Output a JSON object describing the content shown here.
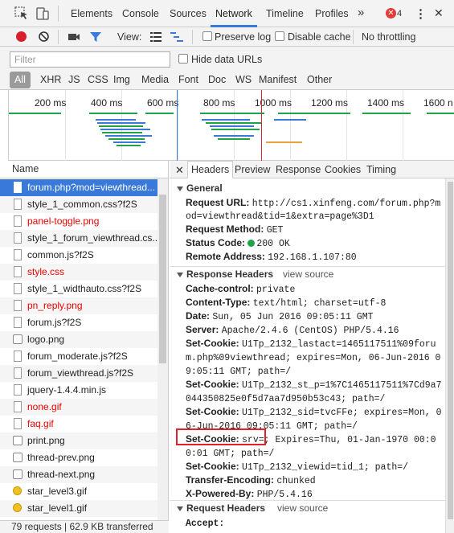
{
  "tabbar": {
    "tabs": [
      "Elements",
      "Console",
      "Sources",
      "Network",
      "Timeline",
      "Profiles"
    ],
    "more": "»",
    "error_count": "4",
    "more_menu": "⋮",
    "close": "✕"
  },
  "toolbar": {
    "view_label": "View:",
    "preserve_log": "Preserve log",
    "disable_cache": "Disable cache",
    "throttling": "No throttling"
  },
  "filter": {
    "placeholder": "Filter",
    "hide_data_urls": "Hide data URLs"
  },
  "types": [
    "All",
    "XHR",
    "JS",
    "CSS",
    "Img",
    "Media",
    "Font",
    "Doc",
    "WS",
    "Manifest",
    "Other"
  ],
  "overview": {
    "ticks": [
      "200 ms",
      "400 ms",
      "600 ms",
      "800 ms",
      "1000 ms",
      "1200 ms",
      "1400 ms",
      "1600 n"
    ]
  },
  "requests": {
    "header": "Name",
    "items": [
      {
        "name": "forum.php?mod=viewthread...",
        "error": false,
        "icon": "doc"
      },
      {
        "name": "style_1_common.css?f2S",
        "error": false,
        "icon": "doc"
      },
      {
        "name": "panel-toggle.png",
        "error": true,
        "icon": "doc"
      },
      {
        "name": "style_1_forum_viewthread.cs...",
        "error": false,
        "icon": "doc"
      },
      {
        "name": "common.js?f2S",
        "error": false,
        "icon": "doc"
      },
      {
        "name": "style.css",
        "error": true,
        "icon": "doc"
      },
      {
        "name": "style_1_widthauto.css?f2S",
        "error": false,
        "icon": "doc"
      },
      {
        "name": "pn_reply.png",
        "error": true,
        "icon": "doc"
      },
      {
        "name": "forum.js?f2S",
        "error": false,
        "icon": "doc"
      },
      {
        "name": "logo.png",
        "error": false,
        "icon": "img"
      },
      {
        "name": "forum_moderate.js?f2S",
        "error": false,
        "icon": "doc"
      },
      {
        "name": "forum_viewthread.js?f2S",
        "error": false,
        "icon": "doc"
      },
      {
        "name": "jquery-1.4.4.min.js",
        "error": false,
        "icon": "doc"
      },
      {
        "name": "none.gif",
        "error": true,
        "icon": "doc"
      },
      {
        "name": "faq.gif",
        "error": true,
        "icon": "doc"
      },
      {
        "name": "print.png",
        "error": false,
        "icon": "img"
      },
      {
        "name": "thread-prev.png",
        "error": false,
        "icon": "img"
      },
      {
        "name": "thread-next.png",
        "error": false,
        "icon": "img"
      },
      {
        "name": "star_level3.gif",
        "error": false,
        "icon": "star"
      },
      {
        "name": "star_level1.gif",
        "error": false,
        "icon": "star"
      }
    ]
  },
  "status": "79 requests  |  62.9 KB transferred",
  "detail": {
    "tabs": [
      "Headers",
      "Preview",
      "Response",
      "Cookies",
      "Timing"
    ],
    "general": {
      "title": "General",
      "url_key": "Request URL:",
      "url_val1": "http://cs1.xinfeng.com/forum.php?m",
      "url_val2": "od=viewthread&tid=1&extra=page%3D1",
      "method_key": "Request Method:",
      "method_val": "GET",
      "status_key": "Status Code:",
      "status_val": "200 OK",
      "remote_key": "Remote Address:",
      "remote_val": "192.168.1.107:80"
    },
    "response_headers": {
      "title": "Response Headers",
      "view_source": "view source",
      "lines": [
        {
          "k": "Cache-control:",
          "v": "private"
        },
        {
          "k": "Content-Type:",
          "v": "text/html; charset=utf-8"
        },
        {
          "k": "Date:",
          "v": "Sun, 05 Jun 2016 09:05:11 GMT"
        },
        {
          "k": "Server:",
          "v": "Apache/2.4.6 (CentOS) PHP/5.4.16"
        },
        {
          "k": "Set-Cookie:",
          "v": "U1Tp_2132_lastact=1465117511%09foru"
        },
        {
          "k": "",
          "v": "m.php%09viewthread; expires=Mon, 06-Jun-2016 0"
        },
        {
          "k": "",
          "v": "9:05:11 GMT; path=/"
        },
        {
          "k": "Set-Cookie:",
          "v": "U1Tp_2132_st_p=1%7C1465117511%7Cd9a7"
        },
        {
          "k": "",
          "v": "044350825e0f5d7aa7d950b53c43; path=/"
        },
        {
          "k": "Set-Cookie:",
          "v": "U1Tp_2132_sid=tvcFFe; expires=Mon, 0"
        },
        {
          "k": "",
          "v": "6-Jun-2016 09:05:11 GMT; path=/"
        },
        {
          "k": "Set-Cookie:",
          "v": "srv=; Expires=Thu, 01-Jan-1970 00:0"
        },
        {
          "k": "",
          "v": "0:01 GMT; path=/"
        },
        {
          "k": "Set-Cookie:",
          "v": "U1Tp_2132_viewid=tid_1; path=/"
        },
        {
          "k": "Transfer-Encoding:",
          "v": "chunked"
        },
        {
          "k": "X-Powered-By:",
          "v": "PHP/5.4.16"
        }
      ]
    },
    "request_headers": {
      "title": "Request Headers",
      "view_source": "view source",
      "first_line": "Accept: text/html,application/xhtml+xml,applica"
    }
  },
  "colors": {
    "accent": "#3879d9",
    "error_text": "#ee0000",
    "status_ok": "#1ea446",
    "highlight": "#e0202a"
  }
}
